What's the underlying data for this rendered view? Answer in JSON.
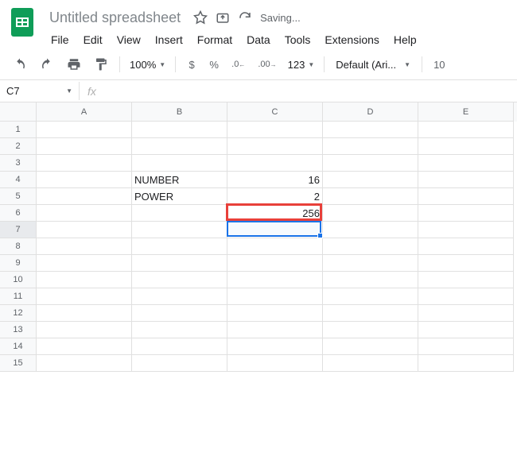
{
  "doc": {
    "title": "Untitled spreadsheet",
    "status": "Saving..."
  },
  "menu": [
    "File",
    "Edit",
    "View",
    "Insert",
    "Format",
    "Data",
    "Tools",
    "Extensions",
    "Help"
  ],
  "toolbar": {
    "zoom": "100%",
    "currency": "$",
    "percent": "%",
    "dec_dec": ".0",
    "inc_dec": ".00",
    "more_fmt": "123",
    "font": "Default (Ari...",
    "font_size": "10"
  },
  "name_box": "C7",
  "formula": "",
  "columns": [
    "A",
    "B",
    "C",
    "D",
    "E"
  ],
  "row_count": 15,
  "cells": {
    "B4": "NUMBER",
    "C4": "16",
    "B5": "POWER",
    "C5": "2",
    "C6": "256"
  },
  "selected": {
    "row": 7,
    "col": "C"
  },
  "highlight": {
    "row": 6,
    "col": "C"
  }
}
